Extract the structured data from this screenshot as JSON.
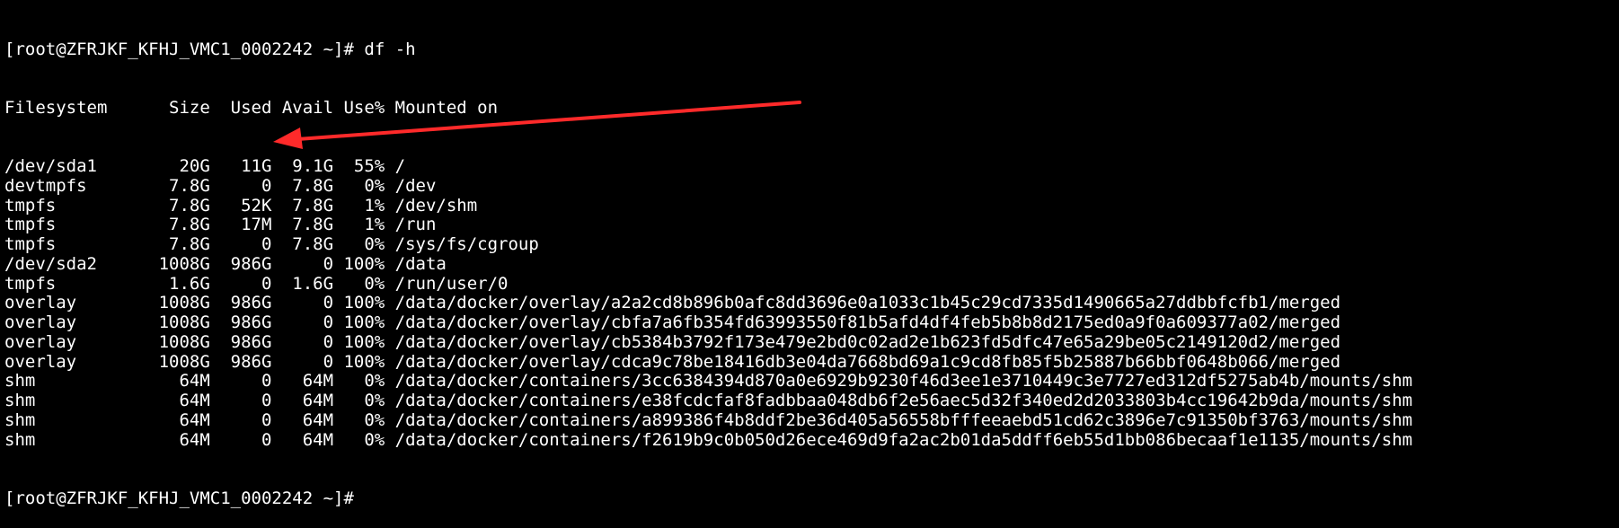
{
  "terminal": {
    "prompt": "[root@ZFRJKF_KFHJ_VMC1_0002242 ~]#",
    "command": "df -h",
    "header": {
      "fs": "Filesystem",
      "size": "Size",
      "used": "Used",
      "avail": "Avail",
      "use": "Use%",
      "mount": "Mounted on"
    },
    "rows": [
      {
        "fs": "/dev/sda1",
        "size": "20G",
        "used": "11G",
        "avail": "9.1G",
        "use": "55%",
        "mount": "/"
      },
      {
        "fs": "devtmpfs",
        "size": "7.8G",
        "used": "0",
        "avail": "7.8G",
        "use": "0%",
        "mount": "/dev"
      },
      {
        "fs": "tmpfs",
        "size": "7.8G",
        "used": "52K",
        "avail": "7.8G",
        "use": "1%",
        "mount": "/dev/shm"
      },
      {
        "fs": "tmpfs",
        "size": "7.8G",
        "used": "17M",
        "avail": "7.8G",
        "use": "1%",
        "mount": "/run"
      },
      {
        "fs": "tmpfs",
        "size": "7.8G",
        "used": "0",
        "avail": "7.8G",
        "use": "0%",
        "mount": "/sys/fs/cgroup"
      },
      {
        "fs": "/dev/sda2",
        "size": "1008G",
        "used": "986G",
        "avail": "0",
        "use": "100%",
        "mount": "/data"
      },
      {
        "fs": "tmpfs",
        "size": "1.6G",
        "used": "0",
        "avail": "1.6G",
        "use": "0%",
        "mount": "/run/user/0"
      },
      {
        "fs": "overlay",
        "size": "1008G",
        "used": "986G",
        "avail": "0",
        "use": "100%",
        "mount": "/data/docker/overlay/a2a2cd8b896b0afc8dd3696e0a1033c1b45c29cd7335d1490665a27ddbbfcfb1/merged"
      },
      {
        "fs": "overlay",
        "size": "1008G",
        "used": "986G",
        "avail": "0",
        "use": "100%",
        "mount": "/data/docker/overlay/cbfa7a6fb354fd63993550f81b5afd4df4feb5b8b8d2175ed0a9f0a609377a02/merged"
      },
      {
        "fs": "overlay",
        "size": "1008G",
        "used": "986G",
        "avail": "0",
        "use": "100%",
        "mount": "/data/docker/overlay/cb5384b3792f173e479e2bd0c02ad2e1b623fd5dfc47e65a29be05c2149120d2/merged"
      },
      {
        "fs": "overlay",
        "size": "1008G",
        "used": "986G",
        "avail": "0",
        "use": "100%",
        "mount": "/data/docker/overlay/cdca9c78be18416db3e04da7668bd69a1c9cd8fb85f5b25887b66bbf0648b066/merged"
      },
      {
        "fs": "shm",
        "size": "64M",
        "used": "0",
        "avail": "64M",
        "use": "0%",
        "mount": "/data/docker/containers/3cc6384394d870a0e6929b9230f46d3ee1e3710449c3e7727ed312df5275ab4b/mounts/shm"
      },
      {
        "fs": "shm",
        "size": "64M",
        "used": "0",
        "avail": "64M",
        "use": "0%",
        "mount": "/data/docker/containers/e38fcdcfaf8fadbbaa048db6f2e56aec5d32f340ed2d2033803b4cc19642b9da/mounts/shm"
      },
      {
        "fs": "shm",
        "size": "64M",
        "used": "0",
        "avail": "64M",
        "use": "0%",
        "mount": "/data/docker/containers/a899386f4b8ddf2be36d405a56558bfffeeaebd51cd62c3896e7c91350bf3763/mounts/shm"
      },
      {
        "fs": "shm",
        "size": "64M",
        "used": "0",
        "avail": "64M",
        "use": "0%",
        "mount": "/data/docker/containers/f2619b9c0b050d26ece469d9fa2ac2b01da5ddff6eb55d1bb086becaaf1e1135/mounts/shm"
      }
    ],
    "next_prompt": "[root@ZFRJKF_KFHJ_VMC1_0002242 ~]#"
  },
  "annotation": {
    "arrow_color": "#ff2a2a"
  },
  "colors": {
    "background": "#000000",
    "text": "#ffffff"
  }
}
